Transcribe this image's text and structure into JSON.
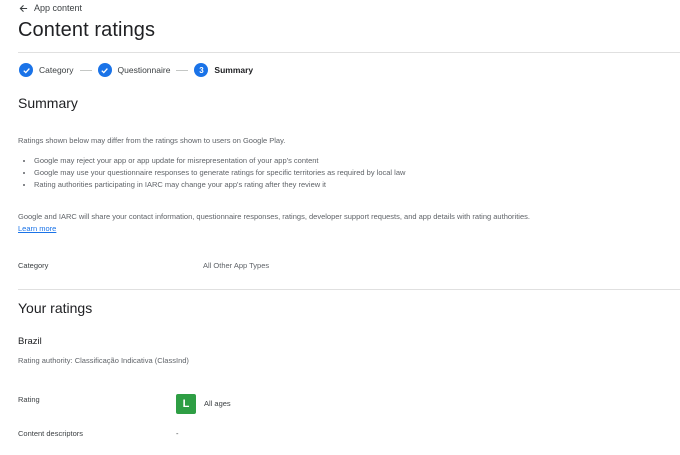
{
  "header": {
    "back_label": "App content",
    "title": "Content ratings"
  },
  "stepper": {
    "steps": [
      {
        "label": "Category",
        "state": "done"
      },
      {
        "label": "Questionnaire",
        "state": "done"
      },
      {
        "label": "Summary",
        "state": "current",
        "number": "3"
      }
    ]
  },
  "summary": {
    "heading": "Summary",
    "intro": "Ratings shown below may differ from the ratings shown to users on Google Play.",
    "bullets": [
      "Google may reject your app or app update for misrepresentation of your app's content",
      "Google may use your questionnaire responses to generate ratings for specific territories as required by local law",
      "Rating authorities participating in IARC may change your app's rating after they review it"
    ],
    "share_text": "Google and IARC will share your contact information, questionnaire responses, ratings, developer support requests, and app details with rating authorities.",
    "learn_more": "Learn more",
    "category_label": "Category",
    "category_value": "All Other App Types"
  },
  "ratings": {
    "heading": "Your ratings",
    "country": "Brazil",
    "authority": "Rating authority: Classificação Indicativa (ClassInd)",
    "rating_label": "Rating",
    "badge_letter": "L",
    "badge_color": "#2e9e44",
    "rating_value": "All ages",
    "descriptors_label": "Content descriptors",
    "descriptors_value": "-"
  },
  "colors": {
    "accent": "#1a73e8",
    "text": "#202124",
    "muted": "#5f6368",
    "divider": "#e0e0e0"
  }
}
